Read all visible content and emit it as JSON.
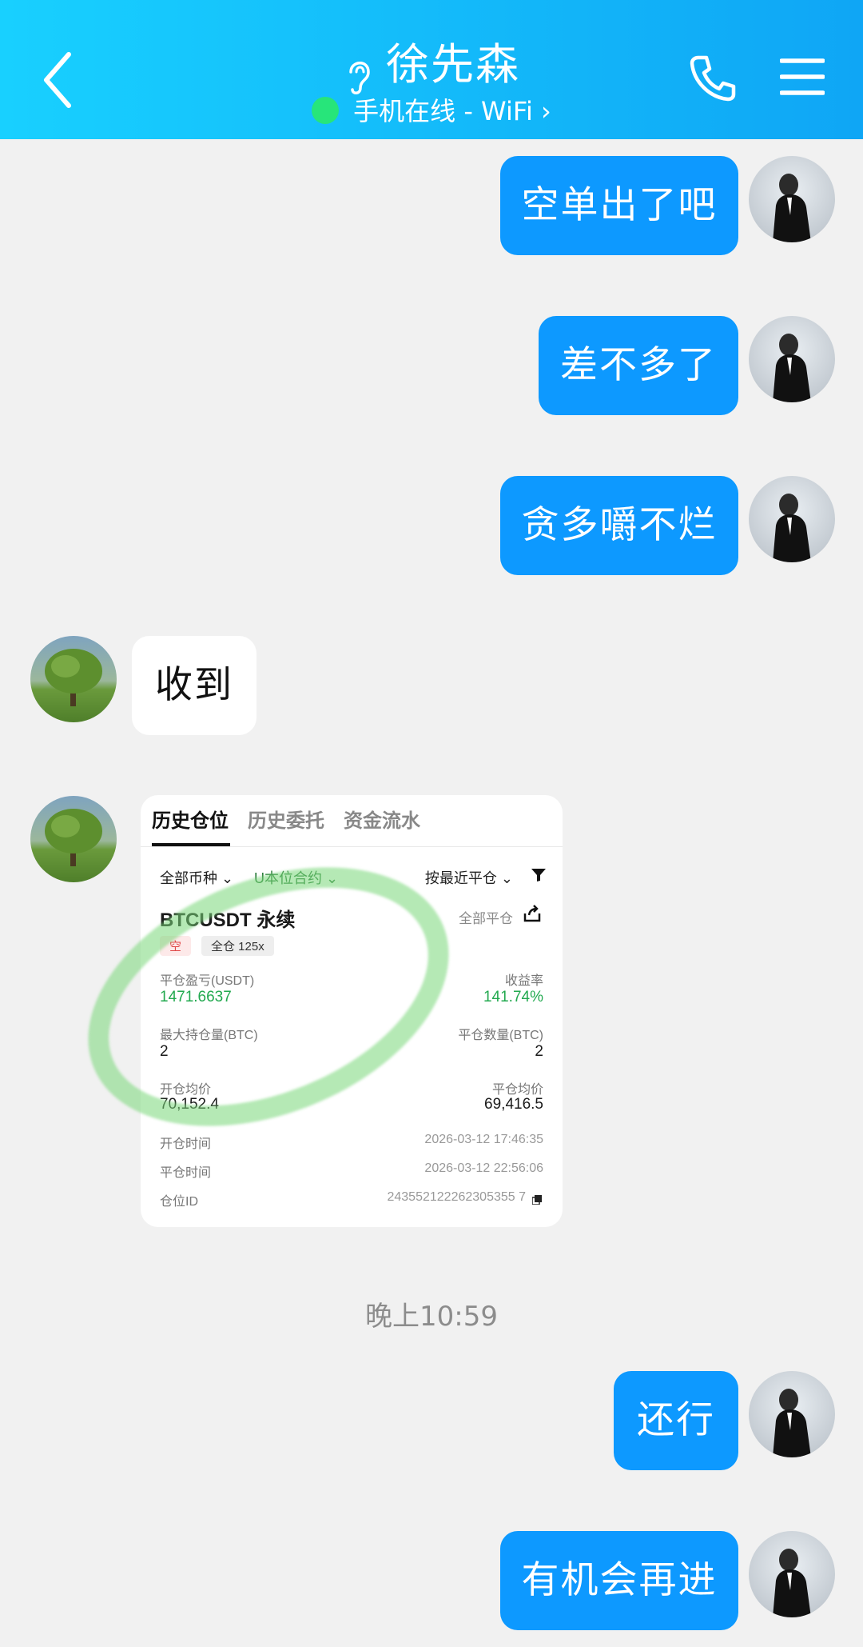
{
  "header": {
    "title": "徐先森",
    "status": "手机在线 - WiFi",
    "status_arrow": "›"
  },
  "messages": [
    {
      "text": "空单出了吧"
    },
    {
      "text": "差不多了"
    },
    {
      "text": "贪多嚼不烂"
    },
    {
      "text": "收到"
    },
    {
      "text": "还行"
    },
    {
      "text": "有机会再进"
    }
  ],
  "time_separator": "晚上10:59",
  "card": {
    "tabs": [
      "历史仓位",
      "历史委托",
      "资金流水"
    ],
    "filters": {
      "coin": "全部币种",
      "contract": "U本位合约",
      "sort": "按最近平仓"
    },
    "pair": "BTCUSDT 永续",
    "close_all": "全部平仓",
    "badge_short": "空",
    "badge_cross": "全仓 125x",
    "pnl_label": "平仓盈亏(USDT)",
    "pnl_value": "1471.6637",
    "roi_label": "收益率",
    "roi_value": "141.74%",
    "max_pos_label": "最大持仓量(BTC)",
    "max_pos_value": "2",
    "close_qty_label": "平仓数量(BTC)",
    "close_qty_value": "2",
    "open_avg_label": "开仓均价",
    "open_avg_value": "70,152.4",
    "close_avg_label": "平仓均价",
    "close_avg_value": "69,416.5",
    "open_time_label": "开仓时间",
    "open_time_value": "2026-03-12 17:46:35",
    "close_time_label": "平仓时间",
    "close_time_value": "2026-03-12 22:56:06",
    "id_label": "仓位ID",
    "id_value": "243552122262305355 7"
  },
  "colors": {
    "header": "#12baf9",
    "outgoing_bubble": "#0d99ff",
    "online_dot": "#27e57a",
    "profit": "#22a94f"
  }
}
